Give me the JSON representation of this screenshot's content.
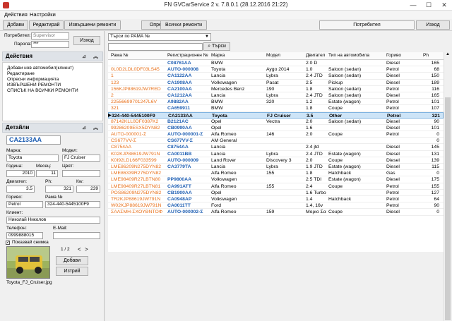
{
  "window": {
    "title": "FN GVCarService 2 v. 7.8.0.1 (28.12.2016 21:22)",
    "minimize": "—",
    "maximize": "☐",
    "close": "✕"
  },
  "menu": [
    "Действия",
    "Настройки"
  ],
  "toolbar": {
    "buttons": [
      "Добави",
      "Редактирай",
      "Извършени ремонти",
      "Опресни",
      "Всички ремонти"
    ],
    "user": "Потребител",
    "logout": "Изход"
  },
  "login": {
    "user_label": "Потребител:",
    "user_placeholder": "Supervisor",
    "pass_label": "Парола:",
    "pass_value": "***",
    "exit": "Изход"
  },
  "actions": {
    "title": "Действия",
    "items": [
      "Добави нов автомобил(клиент)",
      "Редактиране",
      "Опресни информацията",
      "ИЗВЪРШЕНИ РЕМОНТИ",
      "СПИСЪК НА ВСИЧКИ РЕМОНТИ"
    ]
  },
  "details": {
    "title": "Детайли",
    "plate": "CA2133AA",
    "make_label": "Марка:",
    "make": "Toyota",
    "model_label": "Модел:",
    "model": "FJ Cruiser",
    "year_label": "Година:",
    "year": "2010",
    "month_label": "Месец:",
    "month": "11",
    "color_label": "Цвят:",
    "color": "",
    "engine_label": "Двигател:",
    "engine": "3.5",
    "ph_label": "Ph:",
    "ph": "321",
    "kw_label": "Кw:",
    "kw": "239",
    "fuel_label": "Гориво:",
    "fuel": "Petrol",
    "vin_label": "Рама №",
    "vin": "324-440-5445100F9",
    "client_label": "Клиент:",
    "client": "Николай Николов",
    "phone_label": "Телефон:",
    "phone": "0999888015",
    "email_label": "E-Mail:",
    "email": "",
    "show_photo": "Показвай снимка",
    "page": "1 / 2",
    "add": "Добави",
    "delete": "Изтрий",
    "photo_name": "Toyota_FJ_Cruiser.jpg"
  },
  "search": {
    "field": "Търси по РАМА №",
    "query": "",
    "button": "Търси"
  },
  "table": {
    "columns": [
      "Рама №",
      "Регистрационен №",
      "Марка",
      "Модел",
      "Двигател",
      "Тип на автомобила",
      "Гориво",
      "Ph"
    ],
    "rows": [
      [
        "",
        "C08761AA",
        "BMW",
        "",
        "2.0 D",
        "",
        "Diesel",
        "165"
      ],
      [
        "0L0D2LDL0DF03LS45",
        "AUTO-000008",
        "Toyota",
        "Aygo 2014",
        "1.0",
        "Saloon (sedan)",
        "Petrol",
        "68"
      ],
      [
        "1",
        "CA1122AA",
        "Lancia",
        "Lybra",
        "2.4 JTD",
        "Saloon (sedan)",
        "Diesel",
        "150"
      ],
      [
        "123",
        "CA1908AA",
        "Volkswagen",
        "Pasat",
        "2.5",
        "Pickup",
        "Diesel",
        "189"
      ],
      [
        "156KJP88619JW7RED",
        "CA2100AA",
        "Mercedes Benz",
        "190",
        "1.8",
        "Saloon (sedan)",
        "Petrol",
        "116"
      ],
      [
        "2",
        "CA1212AA",
        "Lancia",
        "Lybra",
        "2.4 JTD",
        "Saloon (sedan)",
        "Diesel",
        "165"
      ],
      [
        "22556699701247L6V",
        "A9882AA",
        "BMW",
        "320",
        "1.2",
        "Estate (wagon)",
        "Petrol",
        "101"
      ],
      [
        "321",
        "CA659911",
        "BMW",
        "",
        "1.8",
        "Coupe",
        "Petrol",
        "107"
      ],
      [
        "324-440-5445100F9",
        "CA2133AA",
        "Toyota",
        "FJ Cruiser",
        "3.5",
        "Other",
        "Petrol",
        "321"
      ],
      [
        "87142KLL0DF0387K2",
        "B2121AC",
        "Opel",
        "Vectra",
        "2.0",
        "Saloon (sedan)",
        "Diesel",
        "90"
      ],
      [
        "99286209ESX5DYN82",
        "CB0990AA",
        "Opel",
        "",
        "1.6",
        "",
        "Diesel",
        "101"
      ],
      [
        "AUTO-000001-Σ",
        "AUTO-000001-Σ",
        "Alfa Romeo",
        "146",
        "2.0",
        "Coupe",
        "Petrol",
        "0"
      ],
      [
        "CS677VV-Σ",
        "CS677VV-Σ",
        "AM General",
        "",
        "",
        "",
        "",
        "0"
      ],
      [
        "C8754AA",
        "C8754AA",
        "Lancia",
        "",
        "2.4 jtd",
        "",
        "Diesel",
        "145"
      ],
      [
        "K02KJP88619JW791N",
        "CA0011BB",
        "Lancia",
        "Lybra",
        "2.4 JTD",
        "Estate (wagon)",
        "Diesel",
        "131"
      ],
      [
        "K0I92LDL66F033599",
        "AUTO-000009",
        "Land Rover",
        "Discovery 3",
        "2.0",
        "Coupe",
        "Diesel",
        "139"
      ],
      [
        "LME86209N275DYN82",
        "CA3779TA",
        "Lancia",
        "Lybra",
        "1.9 JTD",
        "Estate (wagon)",
        "Diesel",
        "115"
      ],
      [
        "LME86339R275DYN82",
        "",
        "Alfa Romeo",
        "155",
        "1.8",
        "Hatchback",
        "Gas",
        "0"
      ],
      [
        "LME98409R27LBTN80",
        "PP9800AA",
        "Volkswagen",
        "",
        "2.5 TDI",
        "Estate (wagon)",
        "Diesel",
        "175"
      ],
      [
        "LME98409R27LBTN81",
        "CA991ATT",
        "Alfa Romeo",
        "155",
        "2.4",
        "Coupe",
        "Petrol",
        "155"
      ],
      [
        "POS86209N275DYN82",
        "CB1900AA",
        "Opel",
        "",
        "1.6 Turbo",
        "",
        "Petrol",
        "127"
      ],
      [
        "TR2KJP88619JW791N",
        "CA0948AP",
        "Volkswagen",
        "",
        "1.4",
        "Hatchback",
        "Petrol",
        "64"
      ],
      [
        "W02KJP88619JW791N",
        "CA0011TT",
        "Ford",
        "",
        "1.4, 16v",
        "",
        "Petrol",
        "90"
      ],
      [
        "ΣΑΛΣΜΗ-ΣΧΟΥΘΝΤΟΦ",
        "AUTO-000002-Σ",
        "Alfa Romeo",
        "159",
        "Μοριο Σα",
        "Coupe",
        "Diesel",
        "0"
      ]
    ],
    "selected_index": 8
  },
  "colors": {
    "vin": "#e8701a",
    "plate": "#1f5fb3",
    "selected": "#cde4f7"
  }
}
